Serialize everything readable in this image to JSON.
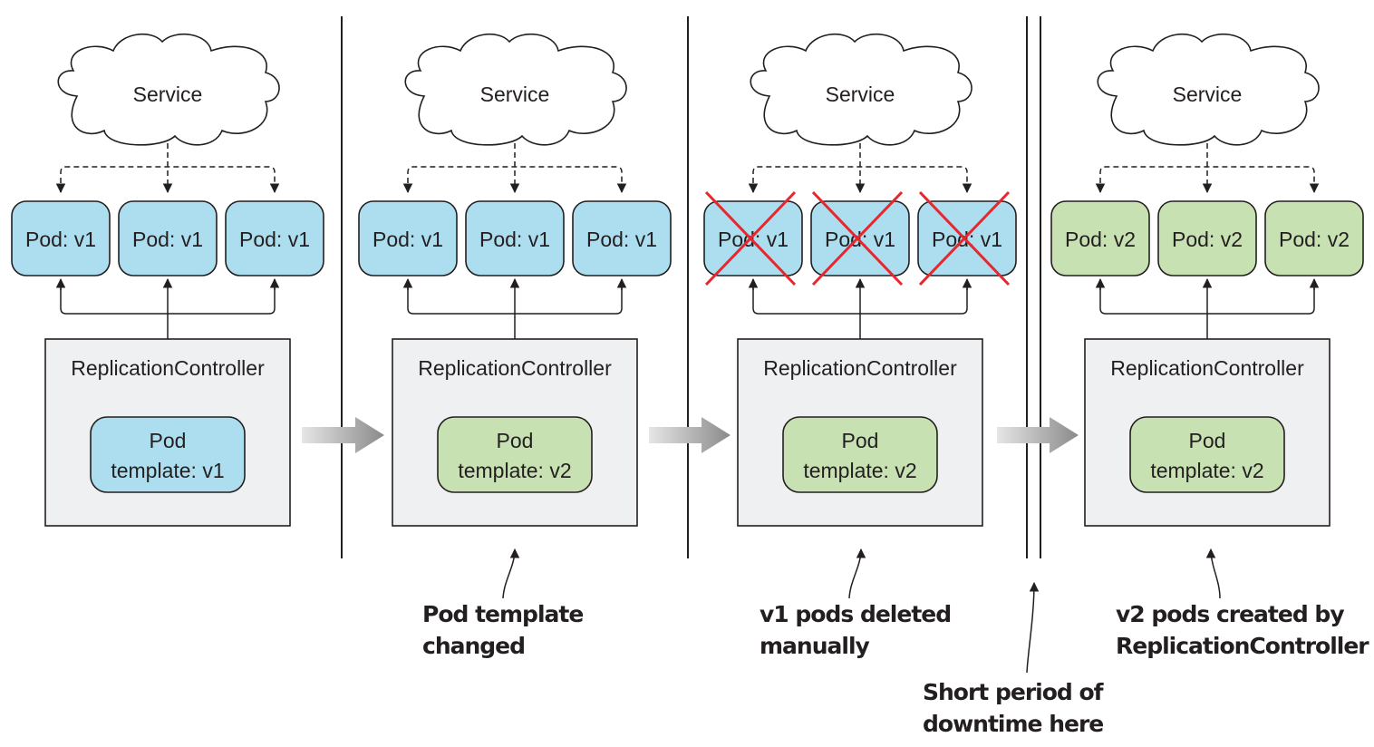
{
  "colors": {
    "pod_v1": "#acdeef",
    "pod_v2": "#c8e1b2",
    "rc_fill": "#eff0f2",
    "stroke": "#231f20",
    "cross": "#e8262d",
    "arrow_gray": "#8e8e8e"
  },
  "stages": [
    {
      "service_label": "Service",
      "pods": [
        {
          "label": "Pod: v1",
          "version": "v1",
          "deleted": false
        },
        {
          "label": "Pod: v1",
          "version": "v1",
          "deleted": false
        },
        {
          "label": "Pod: v1",
          "version": "v1",
          "deleted": false
        }
      ],
      "controller_label": "ReplicationController",
      "template_line1": "Pod",
      "template_line2": "template: v1",
      "template_version": "v1"
    },
    {
      "service_label": "Service",
      "pods": [
        {
          "label": "Pod: v1",
          "version": "v1",
          "deleted": false
        },
        {
          "label": "Pod: v1",
          "version": "v1",
          "deleted": false
        },
        {
          "label": "Pod: v1",
          "version": "v1",
          "deleted": false
        }
      ],
      "controller_label": "ReplicationController",
      "template_line1": "Pod",
      "template_line2": "template: v2",
      "template_version": "v2"
    },
    {
      "service_label": "Service",
      "pods": [
        {
          "label": "Pod: v1",
          "version": "v1",
          "deleted": true
        },
        {
          "label": "Pod: v1",
          "version": "v1",
          "deleted": true
        },
        {
          "label": "Pod: v1",
          "version": "v1",
          "deleted": true
        }
      ],
      "controller_label": "ReplicationController",
      "template_line1": "Pod",
      "template_line2": "template: v2",
      "template_version": "v2"
    },
    {
      "service_label": "Service",
      "pods": [
        {
          "label": "Pod: v2",
          "version": "v2",
          "deleted": false
        },
        {
          "label": "Pod: v2",
          "version": "v2",
          "deleted": false
        },
        {
          "label": "Pod: v2",
          "version": "v2",
          "deleted": false
        }
      ],
      "controller_label": "ReplicationController",
      "template_line1": "Pod",
      "template_line2": "template: v2",
      "template_version": "v2"
    }
  ],
  "annotations": {
    "template_changed": {
      "line1": "Pod template",
      "line2": "changed"
    },
    "pods_deleted": {
      "line1": "v1 pods deleted",
      "line2": "manually"
    },
    "downtime": {
      "line1": "Short period of",
      "line2": "downtime here"
    },
    "pods_created": {
      "line1": "v2 pods created by",
      "line2": "ReplicationController"
    }
  }
}
